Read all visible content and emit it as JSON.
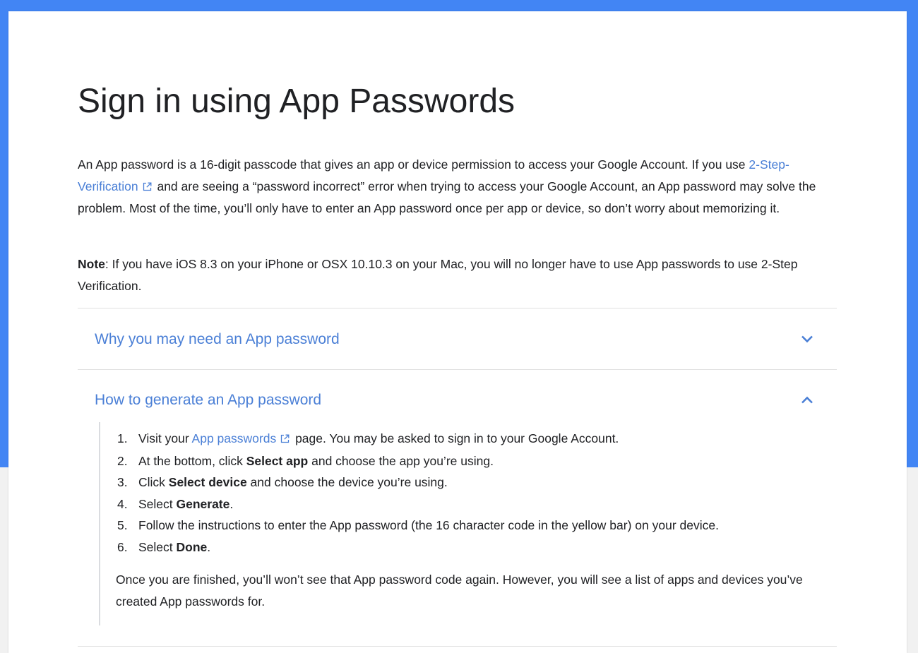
{
  "page": {
    "title": "Sign in using App Passwords",
    "intro": {
      "before_link": "An App password is a 16-digit passcode that gives an app or device permission to access your Google Account. If you use ",
      "link_text": "2-Step-Verification",
      "after_link": " and are seeing a “password incorrect” error when trying to access your Google Account, an App password may solve the problem. Most of the time, you’ll only have to enter an App password once per app or device, so don’t worry about memorizing it."
    },
    "note": {
      "label": "Note",
      "text": ": If you have iOS 8.3 on your iPhone or OSX 10.10.3 on your Mac, you will no longer have to use App passwords to use 2-Step Verification."
    }
  },
  "accordion": [
    {
      "title": "Why you may need an App password",
      "expanded": false,
      "icon": "chevron-down-icon"
    },
    {
      "title": "How to generate an App password",
      "expanded": true,
      "icon": "chevron-up-icon",
      "steps": [
        {
          "num": "1.",
          "pre": "Visit your ",
          "link": "App passwords",
          "post": " page. You may be asked to sign in to your Google Account."
        },
        {
          "num": "2.",
          "pre": "At the bottom, click ",
          "bold": "Select app",
          "post": " and choose the app you’re using."
        },
        {
          "num": "3.",
          "pre": "Click ",
          "bold": "Select device",
          "post": " and choose the device you’re using."
        },
        {
          "num": "4.",
          "pre": "Select ",
          "bold": "Generate",
          "post": "."
        },
        {
          "num": "5.",
          "pre": "Follow the instructions to enter the App password (the 16 character code in the yellow bar) on your device.",
          "post": ""
        },
        {
          "num": "6.",
          "pre": "Select ",
          "bold": "Done",
          "post": "."
        }
      ],
      "finish_text": "Once you are finished, you’ll won’t see that App password code again. However, you will see a list of apps and devices you’ve created App passwords for."
    }
  ],
  "colors": {
    "accent": "#4285f4",
    "link": "#4a7fd6",
    "text": "#202124",
    "divider": "#e0e0e0"
  }
}
